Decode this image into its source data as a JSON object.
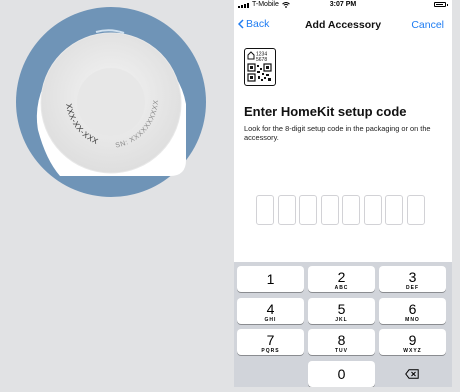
{
  "device": {
    "label_left": "XXX-XX-XXX",
    "label_serial": "SN: XXXXXXXXXX"
  },
  "status_bar": {
    "carrier": "T-Mobile",
    "time": "3:07 PM",
    "battery_level": 0.85
  },
  "nav": {
    "back_label": "Back",
    "title": "Add Accessory",
    "cancel_label": "Cancel"
  },
  "qr": {
    "code_top": "1234",
    "code_bottom": "5678"
  },
  "setup": {
    "title": "Enter HomeKit setup code",
    "description": "Look for the 8-digit setup code in the packaging or on the accessory."
  },
  "code_field_count": 8,
  "keypad": {
    "keys": [
      {
        "num": "1",
        "letters": ""
      },
      {
        "num": "2",
        "letters": "ABC"
      },
      {
        "num": "3",
        "letters": "DEF"
      },
      {
        "num": "4",
        "letters": "GHI"
      },
      {
        "num": "5",
        "letters": "JKL"
      },
      {
        "num": "6",
        "letters": "MNO"
      },
      {
        "num": "7",
        "letters": "PQRS"
      },
      {
        "num": "8",
        "letters": "TUV"
      },
      {
        "num": "9",
        "letters": "WXYZ"
      },
      {
        "num": "0",
        "letters": ""
      }
    ],
    "delete_icon": "backspace-icon"
  },
  "colors": {
    "accent": "#1e7cf2",
    "device_ring": "#6f94b7",
    "background": "#e1e2e4",
    "keyboard": "#d1d4da"
  }
}
